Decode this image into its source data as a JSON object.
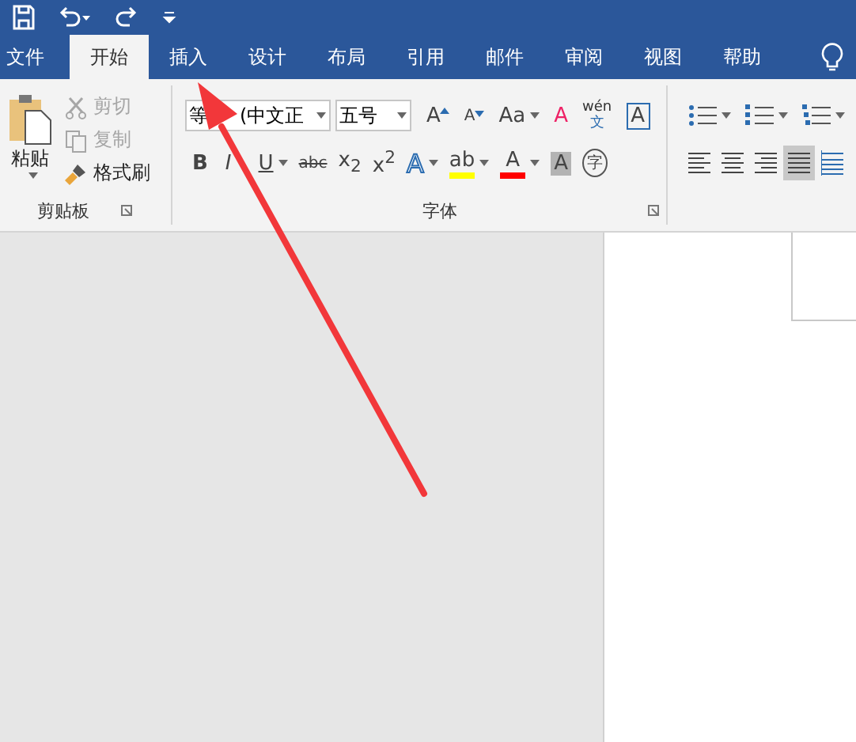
{
  "tabs": [
    {
      "label": "文件",
      "selected": false
    },
    {
      "label": "开始",
      "selected": true
    },
    {
      "label": "插入",
      "selected": false
    },
    {
      "label": "设计",
      "selected": false
    },
    {
      "label": "布局",
      "selected": false
    },
    {
      "label": "引用",
      "selected": false
    },
    {
      "label": "邮件",
      "selected": false
    },
    {
      "label": "审阅",
      "selected": false
    },
    {
      "label": "视图",
      "selected": false
    },
    {
      "label": "帮助",
      "selected": false
    }
  ],
  "clipboard": {
    "paste": "粘贴",
    "label": "剪贴板",
    "items": [
      {
        "kind": "cut",
        "label": "剪切",
        "disabled": true
      },
      {
        "kind": "copy",
        "label": "复制",
        "disabled": true
      },
      {
        "kind": "painter",
        "label": "格式刷",
        "disabled": false
      }
    ]
  },
  "font": {
    "name_parts": [
      "等",
      "(中文正"
    ],
    "size": "五号",
    "label": "字体",
    "row1": [
      {
        "kind": "grow",
        "text": "A",
        "dropdown": false
      },
      {
        "kind": "shrink",
        "text": "A",
        "dropdown": false
      },
      {
        "kind": "case",
        "text": "Aa",
        "dropdown": true
      },
      {
        "kind": "clear",
        "text": "A",
        "dropdown": false
      },
      {
        "kind": "phonetic",
        "text": "wén",
        "subtext": "文",
        "dropdown": false
      },
      {
        "kind": "border",
        "text": "A",
        "dropdown": false
      }
    ],
    "row2": [
      {
        "kind": "bold",
        "text": "B",
        "dropdown": false
      },
      {
        "kind": "italic",
        "text": "I",
        "dropdown": false
      },
      {
        "kind": "underline",
        "text": "U",
        "dropdown": true
      },
      {
        "kind": "strike",
        "text": "abc",
        "dropdown": false
      },
      {
        "kind": "plain",
        "text": "x$_{2}$",
        "dropdown": false
      },
      {
        "kind": "plain",
        "text": "x$^{2}$",
        "dropdown": false
      },
      {
        "kind": "effect",
        "text": "A",
        "dropdown": true
      },
      {
        "kind": "colorbar",
        "text": "ab",
        "dropdown": true,
        "color": "#ffff00"
      },
      {
        "kind": "colorbar",
        "text": "A",
        "dropdown": true,
        "color": "#ff0000"
      },
      {
        "kind": "shade",
        "text": "A",
        "dropdown": false
      },
      {
        "kind": "enclose",
        "text": "字",
        "dropdown": false
      }
    ]
  },
  "paragraph": {
    "lists": [
      {
        "kind": "bullets"
      },
      {
        "kind": "numbers"
      },
      {
        "kind": "multilevel"
      }
    ],
    "alignment": [
      {
        "selected": false
      },
      {
        "selected": false
      },
      {
        "selected": false
      },
      {
        "selected": true
      }
    ]
  }
}
